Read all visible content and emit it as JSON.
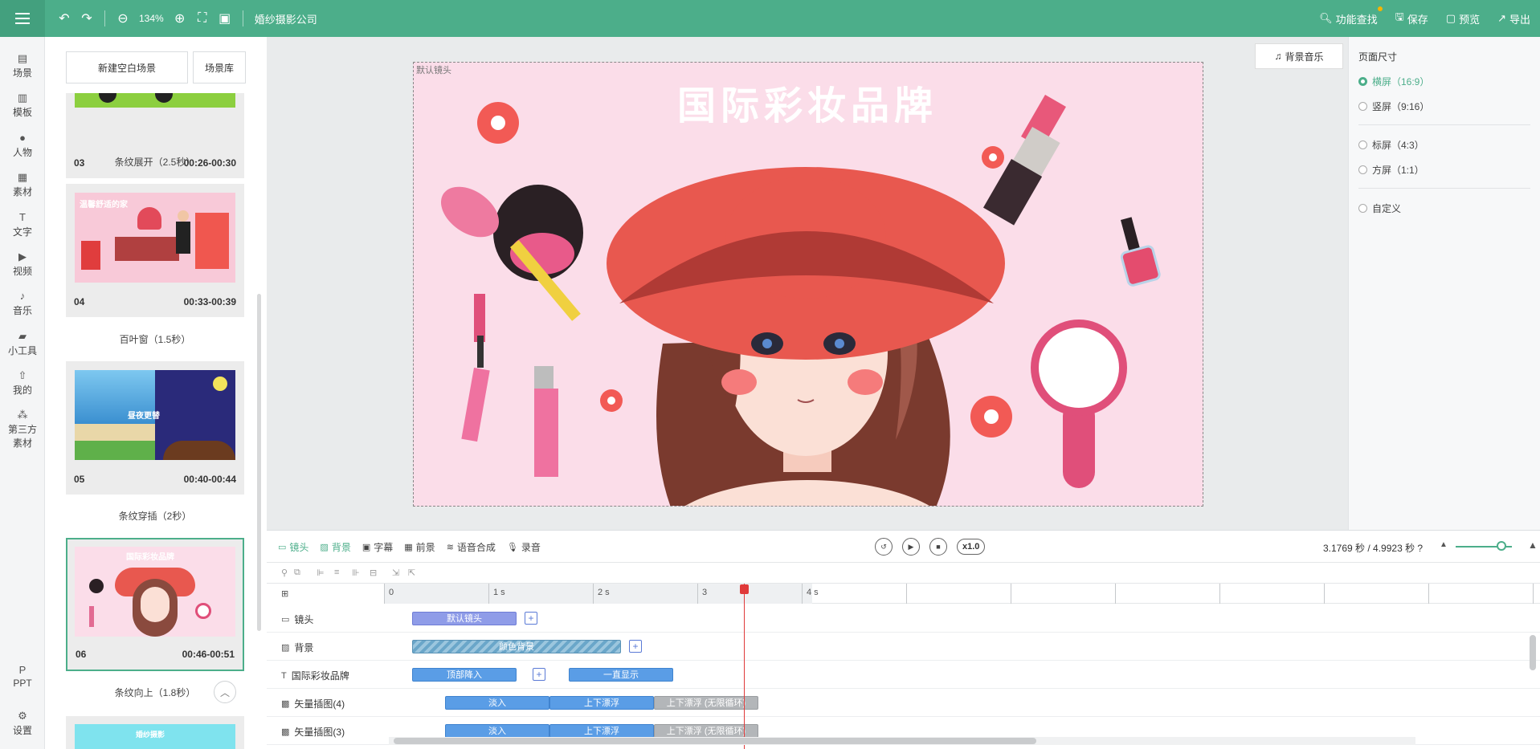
{
  "topbar": {
    "zoom": "134%",
    "project_title": "婚纱摄影公司",
    "actions": [
      {
        "icon": "find-icon",
        "label": "功能查找"
      },
      {
        "icon": "save-icon",
        "label": "保存"
      },
      {
        "icon": "preview-icon",
        "label": "预览"
      },
      {
        "icon": "export-icon",
        "label": "导出"
      }
    ]
  },
  "rail": {
    "items": [
      {
        "icon": "scene-icon",
        "label": "场景"
      },
      {
        "icon": "template-icon",
        "label": "模板"
      },
      {
        "icon": "person-icon",
        "label": "人物"
      },
      {
        "icon": "material-icon",
        "label": "素材"
      },
      {
        "icon": "text-icon",
        "label": "文字"
      },
      {
        "icon": "video-icon",
        "label": "视频"
      },
      {
        "icon": "music-icon",
        "label": "音乐"
      },
      {
        "icon": "tools-icon",
        "label": "小工具"
      },
      {
        "icon": "mine-icon",
        "label": "我的"
      },
      {
        "icon": "third-party-icon",
        "label": "第三方",
        "label2": "素材"
      },
      {
        "icon": "ppt-icon",
        "label": "PPT"
      },
      {
        "icon": "settings-icon",
        "label": "设置"
      }
    ]
  },
  "scenes": {
    "new_blank": "新建空白场景",
    "library": "场景库",
    "cards": [
      {
        "index": "03",
        "range": "00:26-00:30",
        "transition": "条纹展开（2.5秒）"
      },
      {
        "index": "04",
        "range": "00:33-00:39",
        "transition": "百叶窗（1.5秒）",
        "thumb_title": "温馨舒适的家"
      },
      {
        "index": "05",
        "range": "00:40-00:44",
        "transition": "条纹穿插（2秒）",
        "thumb_title": "昼夜更替"
      },
      {
        "index": "06",
        "range": "00:46-00:51",
        "transition": "条纹向上（1.8秒）",
        "thumb_title": "国际彩妆品牌"
      }
    ],
    "next_thumb_title": "婚纱摄影"
  },
  "canvas": {
    "bgm_button": "背景音乐",
    "stage_label": "默认镜头",
    "stage_title": "国际彩妆品牌",
    "colors": {
      "stage_bg": "#fbdde9",
      "hat": "#e8584f",
      "title": "#ffffff"
    }
  },
  "page_size": {
    "title": "页面尺寸",
    "options": [
      {
        "label": "横屏（16:9）",
        "selected": true
      },
      {
        "label": "竖屏（9:16）",
        "selected": false
      },
      {
        "label": "标屏（4:3）",
        "selected": false
      },
      {
        "label": "方屏（1:1）",
        "selected": false
      },
      {
        "label": "自定义",
        "selected": false
      }
    ]
  },
  "timeline": {
    "tabs": [
      {
        "icon": "camera-icon",
        "label": "镜头"
      },
      {
        "icon": "background-icon",
        "label": "背景"
      },
      {
        "icon": "subtitle-icon",
        "label": "字幕"
      },
      {
        "icon": "foreground-icon",
        "label": "前景"
      },
      {
        "icon": "tts-icon",
        "label": "语音合成"
      },
      {
        "icon": "mic-icon",
        "label": "录音"
      }
    ],
    "speed": "x1.0",
    "time_readout": "3.1769 秒 / 4.9923 秒",
    "ruler": [
      "0",
      "1 s",
      "2 s",
      "3",
      "4 s"
    ],
    "tracks": [
      {
        "icon": "camera-icon",
        "name": "镜头",
        "clips": [
          {
            "label": "默认镜头",
            "style": "purple"
          }
        ],
        "plus": true
      },
      {
        "icon": "background-icon",
        "name": "背景",
        "clips": [
          {
            "label": "颜色背景",
            "style": "hatch"
          }
        ],
        "plus": true
      },
      {
        "icon": "text-icon",
        "name": "国际彩妆品牌",
        "clips": [
          {
            "label": "顶部降入",
            "style": "blue"
          },
          {
            "label": "一直显示",
            "style": "blue"
          }
        ],
        "plus": true
      },
      {
        "icon": "image-icon",
        "name": "矢量插图(4)",
        "clips": [
          {
            "label": "淡入",
            "style": "blue"
          },
          {
            "label": "上下漂浮",
            "style": "blue"
          },
          {
            "label": "上下漂浮 (无限循环)",
            "style": "grey"
          }
        ]
      },
      {
        "icon": "image-icon",
        "name": "矢量插图(3)",
        "clips": [
          {
            "label": "淡入",
            "style": "blue"
          },
          {
            "label": "上下漂浮",
            "style": "blue"
          },
          {
            "label": "上下漂浮 (无限循环)",
            "style": "grey"
          }
        ]
      }
    ]
  }
}
